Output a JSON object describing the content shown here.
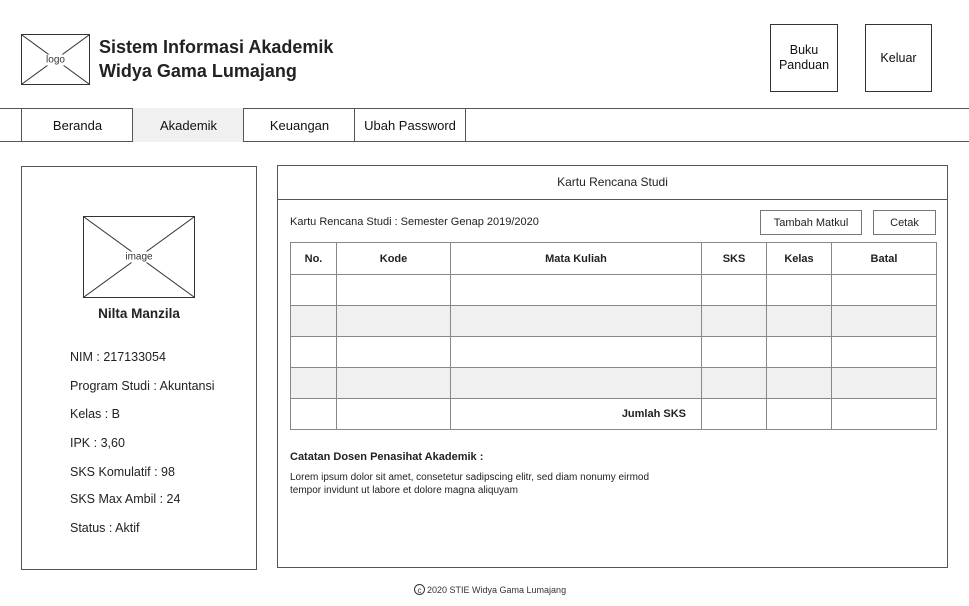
{
  "header": {
    "logo_label": "logo",
    "title_line1": "Sistem Informasi Akademik",
    "title_line2": "Widya Gama Lumajang",
    "guide_button_line1": "Buku",
    "guide_button_line2": "Panduan",
    "logout_button": "Keluar"
  },
  "nav": {
    "items": [
      {
        "label": "Beranda",
        "active": false
      },
      {
        "label": "Akademik",
        "active": true
      },
      {
        "label": "Keuangan",
        "active": false
      },
      {
        "label": "Ubah Password",
        "active": false
      }
    ]
  },
  "profile": {
    "image_label": "image",
    "name": "Nilta Manzila",
    "nim": "NIM : 217133054",
    "program": "Program Studi : Akuntansi",
    "kelas": "Kelas : B",
    "ipk": "IPK : 3,60",
    "sks_kumulatif": "SKS Komulatif : 98",
    "sks_max": "SKS Max Ambil : 24",
    "status": "Status : Aktif"
  },
  "krs": {
    "panel_title": "Kartu Rencana Studi",
    "semester_label": "Kartu Rencana Studi : Semester Genap 2019/2020",
    "add_button": "Tambah Matkul",
    "print_button": "Cetak",
    "columns": [
      "No.",
      "Kode",
      "Mata Kuliah",
      "SKS",
      "Kelas",
      "Batal"
    ],
    "total_label": "Jumlah SKS",
    "notes_title": "Catatan Dosen Penasihat Akademik :",
    "notes_text_line1": "Lorem ipsum dolor sit amet, consetetur sadipscing elitr, sed diam nonumy eirmod",
    "notes_text_line2": "tempor invidunt ut labore et dolore magna aliquyam"
  },
  "footer": {
    "copyright_symbol": "©",
    "text": "2020 STIE Widya Gama Lumajang"
  }
}
